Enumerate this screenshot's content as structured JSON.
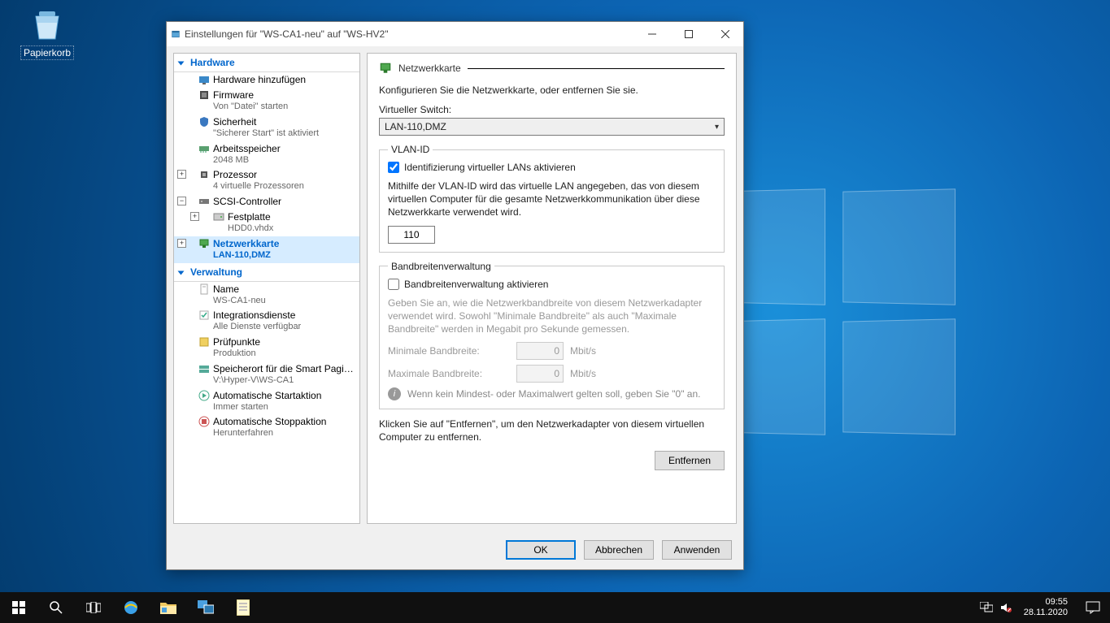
{
  "desktop": {
    "recycle_bin": "Papierkorb"
  },
  "window": {
    "title": "Einstellungen für \"WS-CA1-neu\" auf \"WS-HV2\""
  },
  "sidebar": {
    "hardware_header": "Hardware",
    "add_hardware": "Hardware hinzufügen",
    "firmware": "Firmware",
    "firmware_sub": "Von \"Datei\" starten",
    "security": "Sicherheit",
    "security_sub": "\"Sicherer Start\" ist aktiviert",
    "memory": "Arbeitsspeicher",
    "memory_sub": "2048 MB",
    "processor": "Prozessor",
    "processor_sub": "4 virtuelle Prozessoren",
    "scsi": "SCSI-Controller",
    "harddisk": "Festplatte",
    "harddisk_sub": "HDD0.vhdx",
    "network": "Netzwerkkarte",
    "network_sub": "LAN-110,DMZ",
    "management_header": "Verwaltung",
    "name": "Name",
    "name_sub": "WS-CA1-neu",
    "integration": "Integrationsdienste",
    "integration_sub": "Alle Dienste verfügbar",
    "checkpoints": "Prüfpunkte",
    "checkpoints_sub": "Produktion",
    "smartpaging": "Speicherort für die Smart Paging-D…",
    "smartpaging_sub": "V:\\Hyper-V\\WS-CA1",
    "autostart": "Automatische Startaktion",
    "autostart_sub": "Immer starten",
    "autostop": "Automatische Stoppaktion",
    "autostop_sub": "Herunterfahren"
  },
  "main": {
    "header": "Netzwerkkarte",
    "description": "Konfigurieren Sie die Netzwerkkarte, oder entfernen Sie sie.",
    "vswitch_label": "Virtueller Switch:",
    "vswitch_value": "LAN-110,DMZ",
    "vlan_legend": "VLAN-ID",
    "vlan_enable": "Identifizierung virtueller LANs aktivieren",
    "vlan_hint": "Mithilfe der VLAN-ID wird das virtuelle LAN angegeben, das von diesem virtuellen Computer für die gesamte Netzwerkkommunikation über diese Netzwerkkarte verwendet wird.",
    "vlan_value": "110",
    "bw_legend": "Bandbreitenverwaltung",
    "bw_enable": "Bandbreitenverwaltung aktivieren",
    "bw_hint": "Geben Sie an, wie die Netzwerkbandbreite von diesem Netzwerkadapter verwendet wird. Sowohl \"Minimale Bandbreite\" als auch \"Maximale Bandbreite\" werden in Megabit pro Sekunde gemessen.",
    "bw_min_label": "Minimale Bandbreite:",
    "bw_min_value": "0",
    "bw_max_label": "Maximale Bandbreite:",
    "bw_max_value": "0",
    "bw_unit": "Mbit/s",
    "bw_info": "Wenn kein Mindest- oder Maximalwert gelten soll, geben Sie \"0\" an.",
    "remove_text": "Klicken Sie auf \"Entfernen\", um den Netzwerkadapter von diesem virtuellen Computer zu entfernen.",
    "remove_btn": "Entfernen"
  },
  "footer": {
    "ok": "OK",
    "cancel": "Abbrechen",
    "apply": "Anwenden"
  },
  "taskbar": {
    "time": "09:55",
    "date": "28.11.2020"
  }
}
